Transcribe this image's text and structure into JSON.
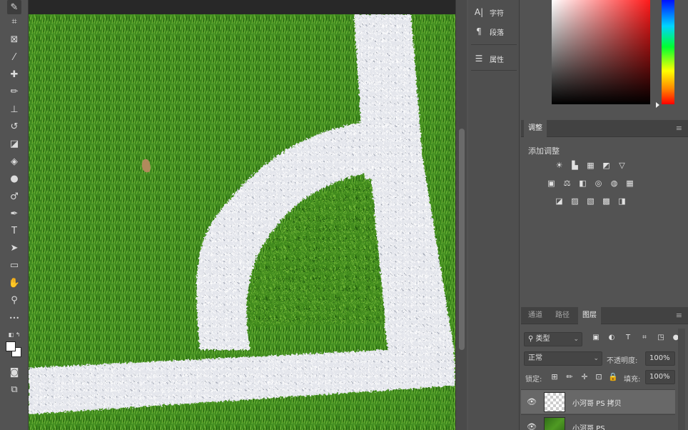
{
  "tools": [
    {
      "name": "quick-selection-icon",
      "glyph": "✎",
      "active": true
    },
    {
      "name": "crop-icon",
      "glyph": "⌗"
    },
    {
      "name": "frame-icon",
      "glyph": "⊠"
    },
    {
      "name": "eyedropper-icon",
      "glyph": "⁄"
    },
    {
      "name": "healing-brush-icon",
      "glyph": "✚"
    },
    {
      "name": "brush-icon",
      "glyph": "✏"
    },
    {
      "name": "clone-stamp-icon",
      "glyph": "⊥"
    },
    {
      "name": "history-brush-icon",
      "glyph": "↺"
    },
    {
      "name": "eraser-icon",
      "glyph": "◪"
    },
    {
      "name": "paint-bucket-icon",
      "glyph": "◈"
    },
    {
      "name": "blur-icon",
      "glyph": "●"
    },
    {
      "name": "dodge-icon",
      "glyph": "♂"
    },
    {
      "name": "pen-icon",
      "glyph": "✒"
    },
    {
      "name": "type-icon",
      "glyph": "T"
    },
    {
      "name": "path-selection-icon",
      "glyph": "➤"
    },
    {
      "name": "rectangle-icon",
      "glyph": "▭"
    },
    {
      "name": "hand-icon",
      "glyph": "✋"
    },
    {
      "name": "zoom-icon",
      "glyph": "⚲"
    },
    {
      "name": "more-tools-icon",
      "glyph": "•••"
    }
  ],
  "strip": {
    "character": {
      "icon": "A|",
      "label": "字符"
    },
    "paragraph": {
      "icon": "¶",
      "label": "段落"
    },
    "properties": {
      "icon": "☰",
      "label": "属性"
    }
  },
  "colors": {
    "foreground": "#ffffff",
    "background": "#ffffff",
    "canvas_grass": "#3f8a1f",
    "line_white": "#e6e8ee"
  },
  "adjustments": {
    "tab": "调整",
    "title": "添加调整",
    "row1": [
      "☀",
      "▙",
      "▦",
      "◩",
      "▽"
    ],
    "row2": [
      "▣",
      "⚖",
      "◧",
      "◎",
      "◍",
      "▦"
    ],
    "row3": [
      "◪",
      "▨",
      "▧",
      "▩",
      "◨"
    ]
  },
  "layers": {
    "tabs": [
      "通道",
      "路径",
      "图层"
    ],
    "active_tab": "图层",
    "filter_label": "类型",
    "blend_mode": "正常",
    "opacity_label": "不透明度:",
    "opacity_value": "100%",
    "lock_label": "锁定:",
    "fill_label": "填充:",
    "fill_value": "100%",
    "items": [
      {
        "name": "小河哥 PS 拷贝",
        "selected": true,
        "visible": true
      },
      {
        "name": "小河哥 PS",
        "selected": false,
        "visible": true
      }
    ]
  }
}
